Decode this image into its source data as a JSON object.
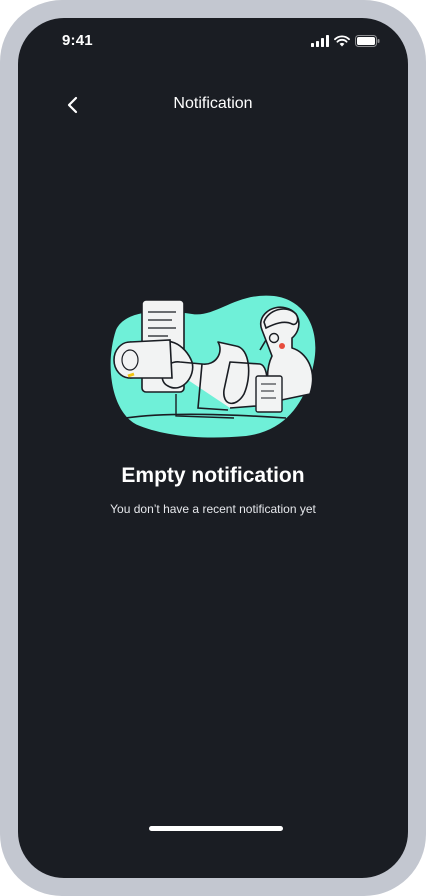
{
  "status_bar": {
    "time": "9:41",
    "icons": [
      "signal-icon",
      "wifi-icon",
      "battery-icon"
    ]
  },
  "header": {
    "back_icon": "chevron-left-icon",
    "title": "Notification"
  },
  "empty_state": {
    "illustration": "empty-notification-illustration",
    "title": "Empty notification",
    "subtitle": "You don’t have a recent notification yet"
  },
  "colors": {
    "background": "#1a1d23",
    "frame": "#c3c7d0",
    "accent": "#6ff0d8",
    "text": "#ffffff"
  }
}
